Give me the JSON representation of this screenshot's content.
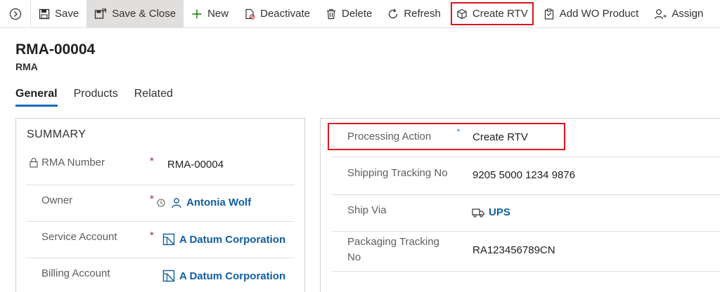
{
  "toolbar": {
    "save": "Save",
    "save_close": "Save & Close",
    "new": "New",
    "deactivate": "Deactivate",
    "delete": "Delete",
    "refresh": "Refresh",
    "create_rtv": "Create RTV",
    "add_wo_product": "Add WO Product",
    "assign": "Assign"
  },
  "header": {
    "title": "RMA-00004",
    "subtitle": "RMA"
  },
  "tabs": [
    {
      "label": "General",
      "active": true
    },
    {
      "label": "Products",
      "active": false
    },
    {
      "label": "Related",
      "active": false
    }
  ],
  "summary": {
    "title": "SUMMARY",
    "fields": [
      {
        "label": "RMA Number",
        "required": "*",
        "value": "RMA-00004"
      },
      {
        "label": "Owner",
        "required": "*",
        "value": "Antonia Wolf"
      },
      {
        "label": "Service Account",
        "required": "*",
        "value": "A Datum Corporation"
      },
      {
        "label": "Billing Account",
        "required": "",
        "value": "A Datum Corporation"
      }
    ]
  },
  "details": {
    "fields": [
      {
        "label": "Processing Action",
        "required": "+",
        "value": "Create RTV"
      },
      {
        "label": "Shipping Tracking No",
        "value": "9205 5000 1234 9876"
      },
      {
        "label": "Ship Via",
        "value": "UPS"
      },
      {
        "label_line1": "Packaging Tracking",
        "label_line2": "No",
        "value": "RA123456789CN"
      }
    ]
  },
  "colors": {
    "accent": "#0f6cbd",
    "link": "#115ea3",
    "highlight": "#e0141e",
    "required": "#a4262c"
  }
}
